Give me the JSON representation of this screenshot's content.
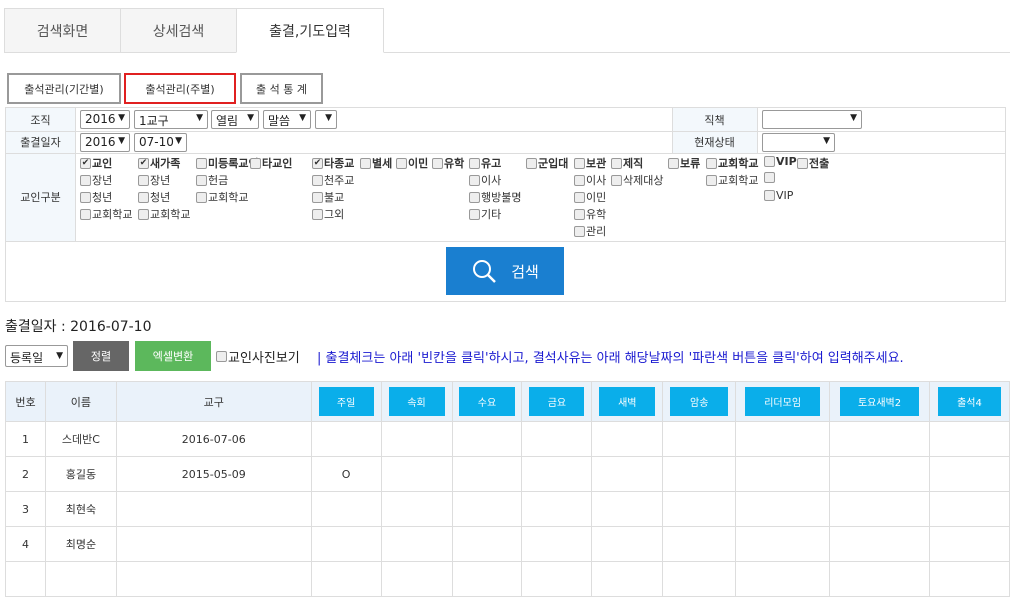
{
  "tabs": [
    "검색화면",
    "상세검색",
    "출결,기도입력"
  ],
  "subtabs": [
    "출석관리(기간별)",
    "출석관리(주별)",
    "출 석 통 계"
  ],
  "filters": {
    "org_label": "조직",
    "org_year": "2016",
    "org_district": "1교구",
    "org_group": "열림",
    "org_sub": "말씀",
    "org_extra": "",
    "date_label": "출결일자",
    "date_year": "2016",
    "date_md": "07-10",
    "position_label": "직책",
    "position_value": "",
    "status_label": "현재상태",
    "status_value": "",
    "member_type_label": "교인구분",
    "member_columns": [
      [
        {
          "l": "교인",
          "c": true,
          "b": true
        },
        {
          "l": "장년"
        },
        {
          "l": "청년"
        },
        {
          "l": "교회학교"
        }
      ],
      [
        {
          "l": "새가족",
          "c": true,
          "b": true
        },
        {
          "l": "장년"
        },
        {
          "l": "청년"
        },
        {
          "l": "교회학교"
        }
      ],
      [
        {
          "l": "미등록교인",
          "b": true
        },
        {
          "l": "헌금"
        },
        {
          "l": "교회학교"
        }
      ],
      [
        {
          "l": "타교인",
          "b": true
        }
      ],
      [
        {
          "l": "타종교",
          "c": true,
          "b": true
        },
        {
          "l": "천주교"
        },
        {
          "l": "불교"
        },
        {
          "l": "그외"
        }
      ],
      [
        {
          "l": "별세",
          "b": true
        }
      ],
      [
        {
          "l": "이민",
          "b": true
        }
      ],
      [
        {
          "l": "유학",
          "b": true
        }
      ],
      [
        {
          "l": "유고",
          "b": true
        },
        {
          "l": "이사"
        },
        {
          "l": "행방불명"
        },
        {
          "l": "기타"
        }
      ],
      [
        {
          "l": "군입대",
          "b": true
        }
      ],
      [
        {
          "l": "보관",
          "b": true
        },
        {
          "l": "이사"
        },
        {
          "l": "이민"
        },
        {
          "l": "유학"
        },
        {
          "l": "관리"
        }
      ],
      [
        {
          "l": "제직",
          "b": true
        },
        {
          "l": "삭제대상"
        }
      ],
      [
        {
          "l": "보류",
          "b": true
        }
      ],
      [
        {
          "l": "교회학교",
          "b": true
        },
        {
          "l": "교회학교"
        }
      ],
      [
        {
          "l": "VIP",
          "b": true
        },
        {
          "l": ""
        },
        {
          "l": "VIP"
        }
      ],
      [
        {
          "l": "전출",
          "b": true
        }
      ]
    ],
    "search_label": "검색"
  },
  "date_heading": "출결일자 : 2016-07-10",
  "controls": {
    "sort": "등록일",
    "sort_btn": "정렬",
    "excel_btn": "엑셀변환",
    "photo_label": "교인사진보기",
    "notice": "| 출결체크는 아래 '빈칸을 클릭'하시고, 결석사유는 아래 해당날짜의 '파란색 버튼을 클릭'하여 입력해주세요."
  },
  "table": {
    "headers": [
      "번호",
      "이름",
      "교구"
    ],
    "days": [
      "주일",
      "속회",
      "수요",
      "금요",
      "새벽",
      "암송",
      "리더모임",
      "토요새벽2",
      "출석4"
    ],
    "rows": [
      {
        "no": "1",
        "name": "스데반C",
        "district": "2016-07-06",
        "marks": [
          "",
          "",
          "",
          "",
          "",
          "",
          "",
          "",
          ""
        ]
      },
      {
        "no": "2",
        "name": "홍길동",
        "district": "2015-05-09",
        "marks": [
          "O",
          "",
          "",
          "",
          "",
          "",
          "",
          "",
          ""
        ]
      },
      {
        "no": "3",
        "name": "최현숙",
        "district": "",
        "marks": [
          "",
          "",
          "",
          "",
          "",
          "",
          "",
          "",
          ""
        ]
      },
      {
        "no": "4",
        "name": "최명순",
        "district": "",
        "marks": [
          "",
          "",
          "",
          "",
          "",
          "",
          "",
          "",
          ""
        ]
      },
      {
        "no": "",
        "name": "",
        "district": "",
        "marks": [
          "",
          "",
          "",
          "",
          "",
          "",
          "",
          "",
          ""
        ]
      }
    ]
  }
}
